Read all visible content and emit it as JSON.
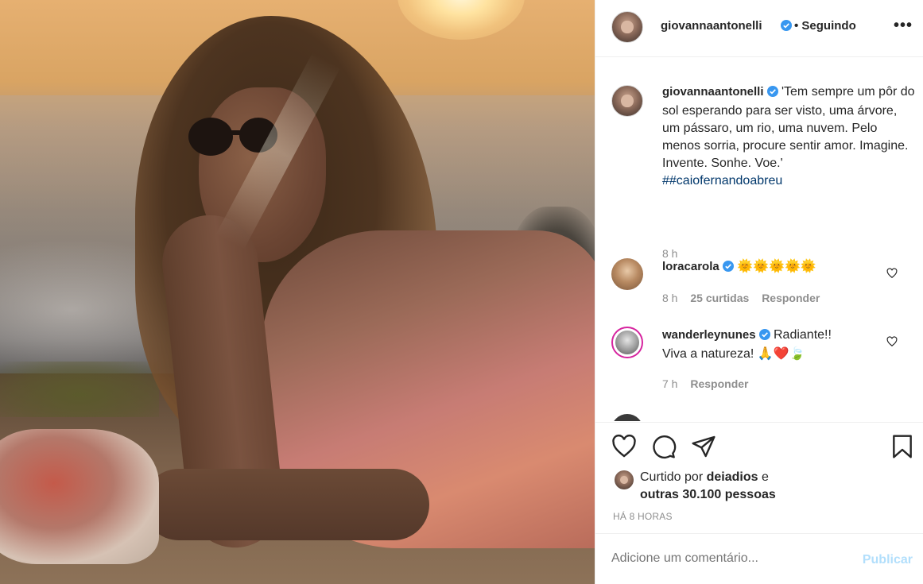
{
  "post": {
    "author": "giovannaantonelli",
    "follow_status": "• Seguindo",
    "more_icon": "more-horizontal-icon",
    "caption": {
      "text": "'Tem sempre um pôr do sol esperando para ser visto, uma árvore, um pássaro, um rio, uma nuvem. Pelo menos sorria, procure sentir amor. Imagine. Invente. Sonhe. Voe.'",
      "hashtag": "##caiofernandoabreu",
      "time": "8 h"
    }
  },
  "comments": [
    {
      "username": "loracarola",
      "text": "🌞🌞🌞🌞🌞",
      "time": "8 h",
      "likes": "25 curtidas",
      "reply": "Responder"
    },
    {
      "username": "wanderleynunes",
      "text_line1": "Radiante!!",
      "text_line2": "Viva a natureza! 🙏❤️🍃",
      "time": "7 h",
      "reply": "Responder"
    }
  ],
  "likes": {
    "prefix": "Curtido por",
    "user": "deiadios",
    "connector": "e",
    "others": "outras 30.100 pessoas"
  },
  "posted_ago": "HÁ 8 HORAS",
  "add_comment": {
    "placeholder": "Adicione um comentário...",
    "publish": "Publicar"
  },
  "colors": {
    "verified": "#3897f0",
    "hashtag": "#00376b",
    "publish_disabled": "#b2dffc",
    "heart_red": "#ed4956"
  }
}
